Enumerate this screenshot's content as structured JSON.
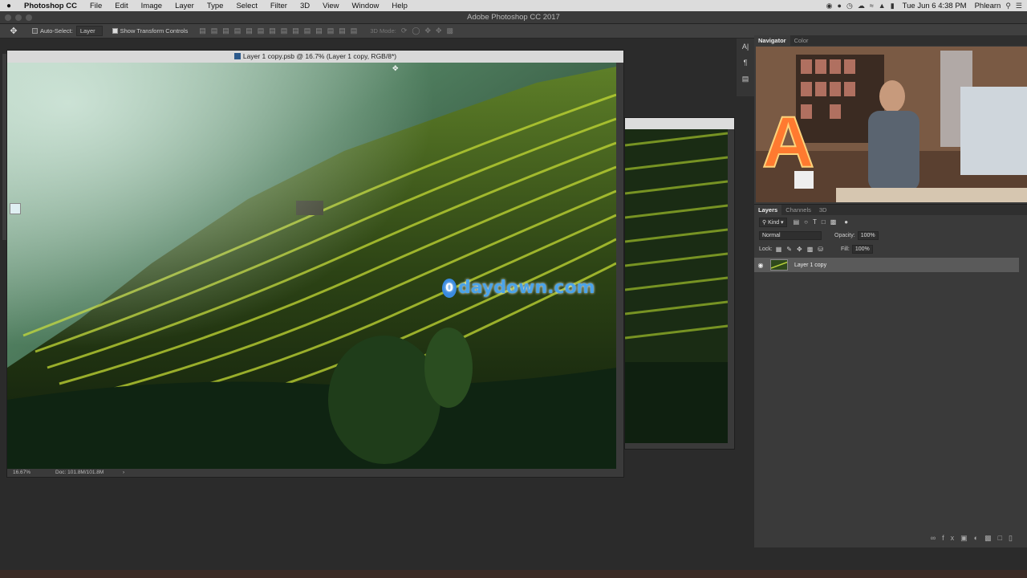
{
  "menubar": {
    "app": "Photoshop CC",
    "items": [
      "File",
      "Edit",
      "Image",
      "Layer",
      "Type",
      "Select",
      "Filter",
      "3D",
      "View",
      "Window",
      "Help"
    ],
    "clock": "Tue Jun 6 4:38 PM",
    "user": "Phlearn"
  },
  "window": {
    "title": "Adobe Photoshop CC 2017"
  },
  "options": {
    "auto_select": "Auto-Select:",
    "target": "Layer",
    "transform": "Show Transform Controls",
    "mode_3d": "3D Mode:"
  },
  "document": {
    "title": "Layer 1 copy.psb @ 16.7% (Layer 1 copy, RGB/8*)",
    "zoom": "16.67%",
    "doc_size": "Doc: 101.8M/101.8M"
  },
  "panels": {
    "nav_tabs": [
      "Navigator",
      "Color"
    ],
    "layer_tabs": [
      "Layers",
      "Channels",
      "3D"
    ],
    "kind": "Kind",
    "blend": "Normal",
    "opacity_label": "Opacity:",
    "opacity": "100%",
    "lock_label": "Lock:",
    "fill_label": "Fill:",
    "fill": "100%"
  },
  "layers": [
    {
      "name": "Layer 1 copy",
      "visible": true
    }
  ],
  "watermark": {
    "icon": "0",
    "text": "daydown.com"
  },
  "colors": {
    "foreground": "#dfeff2",
    "background": "#ffffff",
    "accent": "#4ba3e8"
  }
}
